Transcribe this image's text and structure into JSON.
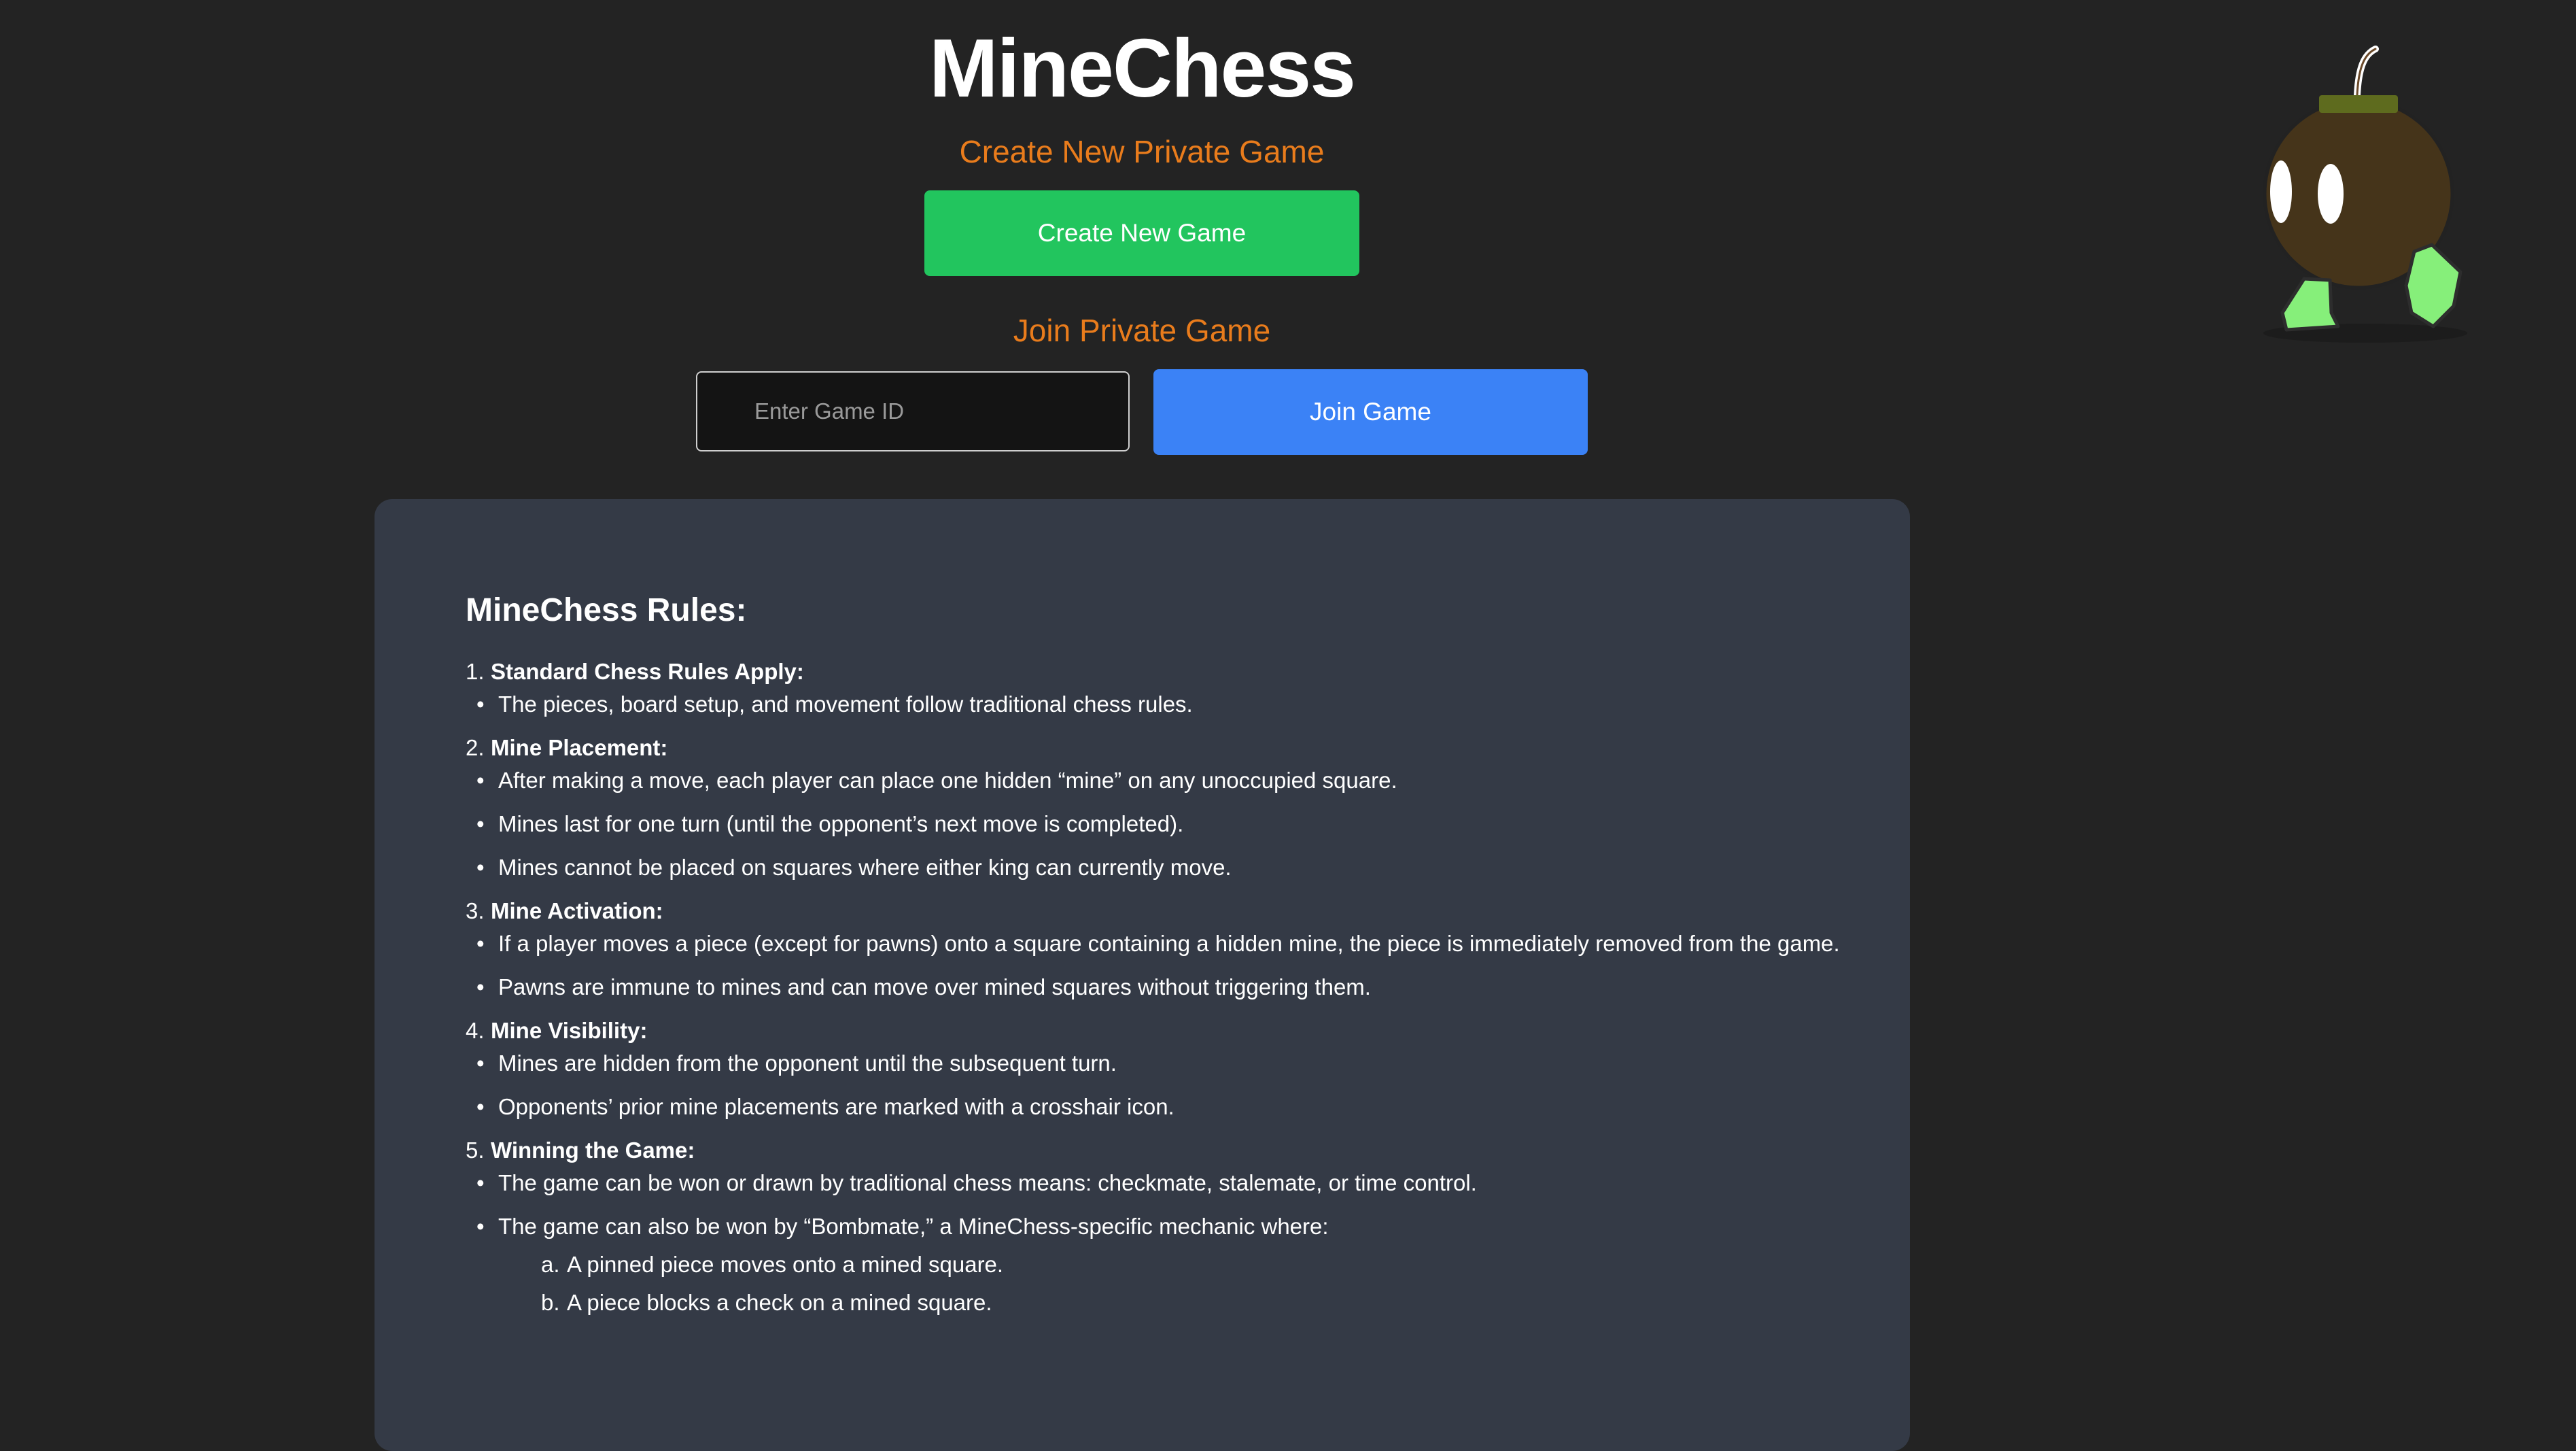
{
  "app": {
    "title": "MineChess"
  },
  "create": {
    "heading": "Create New Private Game",
    "button_label": "Create New Game"
  },
  "join": {
    "heading": "Join Private Game",
    "input_placeholder": "Enter Game ID",
    "input_value": "",
    "button_label": "Join Game"
  },
  "rules": {
    "title": "MineChess Rules:",
    "items": [
      {
        "number": "1.",
        "title": "Standard Chess Rules Apply:",
        "bullets": [
          "The pieces, board setup, and movement follow traditional chess rules."
        ]
      },
      {
        "number": "2.",
        "title": "Mine Placement:",
        "bullets": [
          "After making a move, each player can place one hidden “mine” on any unoccupied square.",
          "Mines last for one turn (until the opponent’s next move is completed).",
          "Mines cannot be placed on squares where either king can currently move."
        ]
      },
      {
        "number": "3.",
        "title": "Mine Activation:",
        "bullets": [
          "If a player moves a piece (except for pawns) onto a square containing a hidden mine, the piece is immediately removed from the game.",
          "Pawns are immune to mines and can move over mined squares without triggering them."
        ]
      },
      {
        "number": "4.",
        "title": "Mine Visibility:",
        "bullets": [
          "Mines are hidden from the opponent until the subsequent turn.",
          "Opponents’ prior mine placements are marked with a crosshair icon."
        ]
      },
      {
        "number": "5.",
        "title": "Winning the Game:",
        "bullets": [
          "The game can be won or drawn by traditional chess means: checkmate, stalemate, or time control.",
          "The game can also be won by “Bombmate,” a MineChess-specific mechanic where:"
        ],
        "subitems": [
          {
            "letter": "a.",
            "text": "A pinned piece moves onto a mined square."
          },
          {
            "letter": "b.",
            "text": "A piece blocks a check on a mined square."
          }
        ]
      }
    ]
  },
  "mascot": {
    "icon": "bomb-mascot-icon"
  },
  "colors": {
    "background": "#232323",
    "accent_heading": "#e97c1c",
    "create_button": "#22c55e",
    "join_button": "#3b82f6",
    "rules_card": "#343a46"
  }
}
